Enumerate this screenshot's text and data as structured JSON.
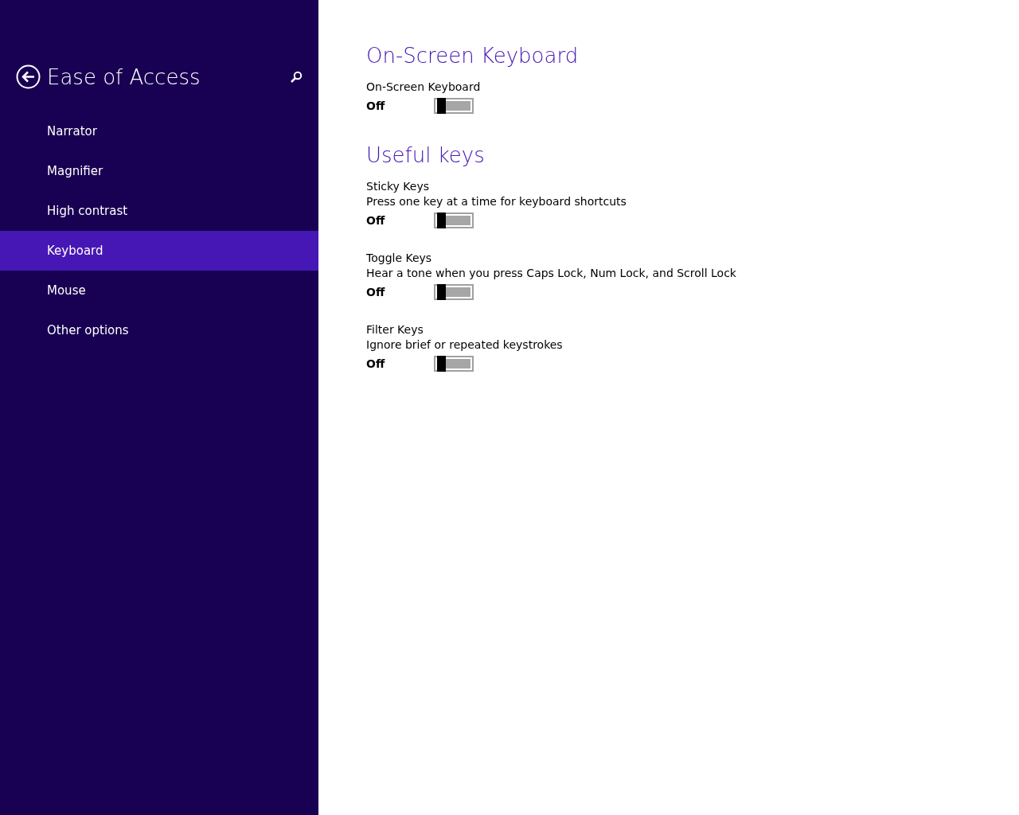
{
  "sidebar": {
    "title": "Ease of Access",
    "items": [
      {
        "label": "Narrator",
        "selected": false
      },
      {
        "label": "Magnifier",
        "selected": false
      },
      {
        "label": "High contrast",
        "selected": false
      },
      {
        "label": "Keyboard",
        "selected": true
      },
      {
        "label": "Mouse",
        "selected": false
      },
      {
        "label": "Other options",
        "selected": false
      }
    ]
  },
  "sections": [
    {
      "heading": "On-Screen Keyboard",
      "settings": [
        {
          "label": "On-Screen Keyboard",
          "state_text": "Off",
          "on": false
        }
      ]
    },
    {
      "heading": "Useful keys",
      "settings": [
        {
          "label": "Sticky Keys",
          "description": "Press one key at a time for keyboard shortcuts",
          "state_text": "Off",
          "on": false
        },
        {
          "label": "Toggle Keys",
          "description": "Hear a tone when you press Caps Lock, Num Lock, and Scroll Lock",
          "state_text": "Off",
          "on": false
        },
        {
          "label": "Filter Keys",
          "description": "Ignore brief or repeated keystrokes",
          "state_text": "Off",
          "on": false
        }
      ]
    }
  ]
}
